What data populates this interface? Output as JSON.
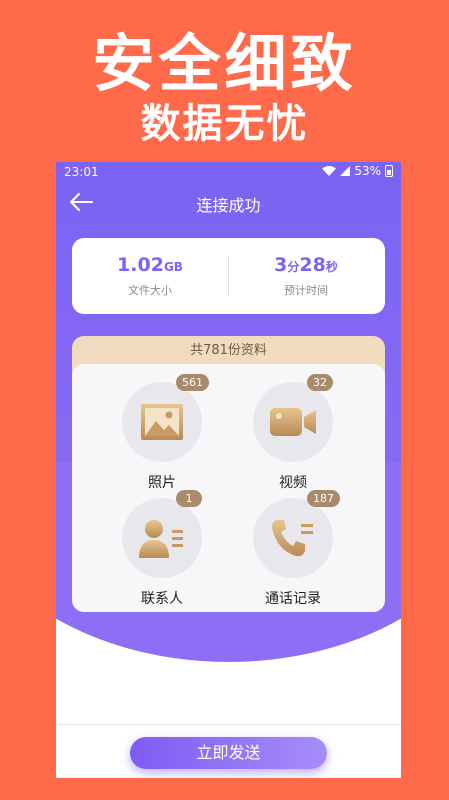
{
  "promo": {
    "title": "安全细致",
    "subtitle": "数据无忧"
  },
  "status": {
    "time": "23:01",
    "battery": "53%"
  },
  "nav": {
    "title": "连接成功"
  },
  "stats": {
    "size_value": "1.02",
    "size_unit": "GB",
    "size_label": "文件大小",
    "time_min": "3",
    "time_min_unit": "分",
    "time_sec": "28",
    "time_sec_unit": "秒",
    "time_label": "预计时间"
  },
  "data": {
    "header": "共781份资料",
    "items": [
      {
        "label": "照片",
        "count": "561",
        "icon": "photo-icon"
      },
      {
        "label": "视频",
        "count": "32",
        "icon": "video-icon"
      },
      {
        "label": "联系人",
        "count": "1",
        "icon": "contacts-icon"
      },
      {
        "label": "通话记录",
        "count": "187",
        "icon": "call-log-icon"
      }
    ]
  },
  "action": {
    "send_label": "立即发送"
  },
  "colors": {
    "background": "#ff6a4a",
    "accent": "#7b63f3",
    "gold": "#c9a06a"
  }
}
